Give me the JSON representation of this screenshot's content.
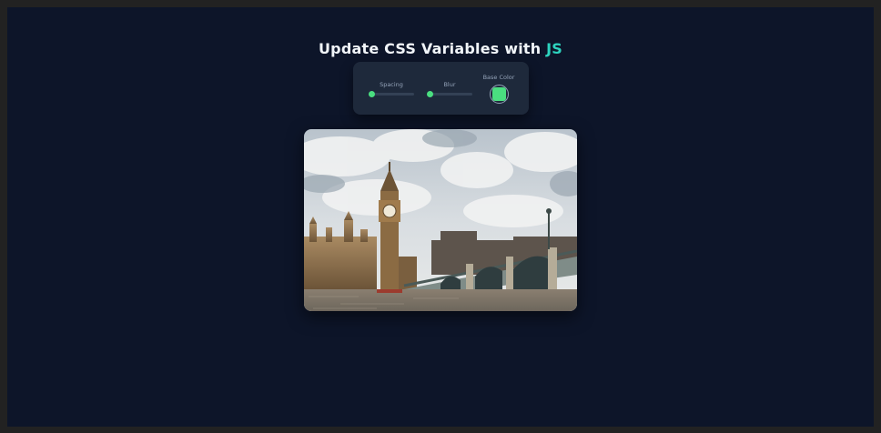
{
  "page": {
    "title_main": "Update CSS Variables with ",
    "title_accent": "JS"
  },
  "controls": {
    "spacing": {
      "label": "Spacing",
      "value": 0.0
    },
    "blur": {
      "label": "Blur",
      "value": 0.0
    },
    "base_color": {
      "label": "Base Color",
      "value": "#4ade80"
    }
  },
  "image": {
    "subject": "big-ben-westminster-bridge-photo"
  },
  "colors": {
    "background": "#0d1529",
    "panel": "#1e293b",
    "accent_text": "#2dd4bf",
    "slider_accent": "#4ade80"
  }
}
